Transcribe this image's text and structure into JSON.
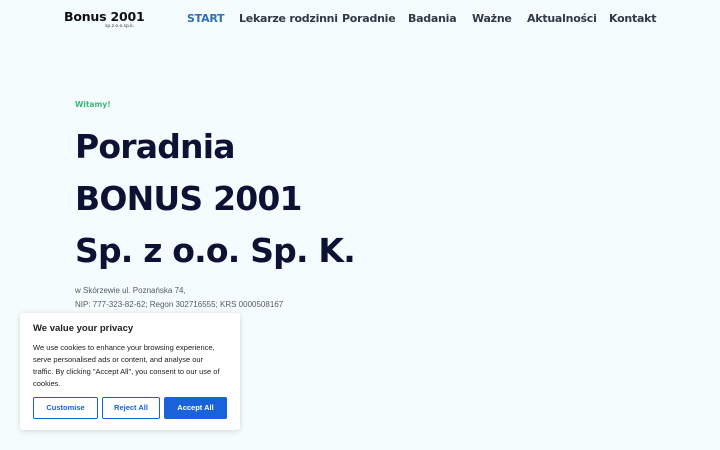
{
  "header": {
    "logo_main": "Bonus 2001",
    "logo_sub": "sp.z.o.o.sp.k.",
    "nav": [
      {
        "label": "START",
        "active": true
      },
      {
        "label": "Lekarze rodzinni",
        "active": false
      },
      {
        "label": "Poradnie",
        "active": false
      },
      {
        "label": "Badania",
        "active": false
      },
      {
        "label": "Ważne",
        "active": false
      },
      {
        "label": "Aktualności",
        "active": false
      },
      {
        "label": "Kontakt",
        "active": false
      }
    ]
  },
  "hero": {
    "kicker": "Witamy!",
    "title_lines": [
      "Poradnia",
      "BONUS 2001",
      "Sp. z o.o. Sp. K."
    ],
    "address_lines": [
      "w Skórzewie ul. Poznańska 74,",
      "NIP: 777-323-82-62; Regon 302716555; KRS 0000508167"
    ],
    "partial_text": ","
  },
  "cookie_banner": {
    "title": "We value your privacy",
    "text_lines": [
      "We use cookies to enhance your browsing experience,",
      "serve personalised ads or content, and analyse our",
      "traffic. By clicking \"Accept All\", you consent to our use of",
      "cookies."
    ],
    "buttons": {
      "customise": "Customise",
      "reject": "Reject All",
      "accept": "Accept All"
    }
  },
  "colors": {
    "page_bg": "#f4fcfd",
    "heading": "#0b1233",
    "nav_text": "#333845",
    "nav_active": "#2f6fb6",
    "kicker": "#3cb77a",
    "cookie_accent": "#1863dc"
  }
}
